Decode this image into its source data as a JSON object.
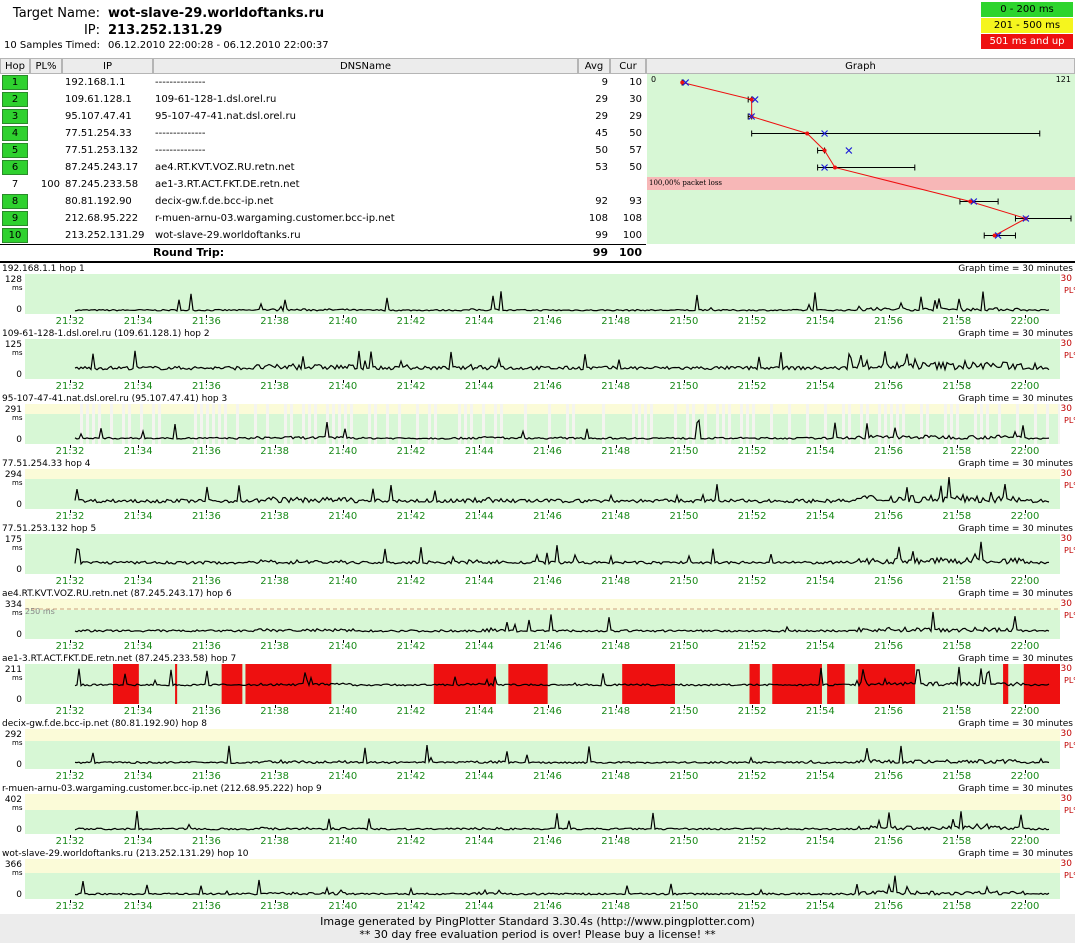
{
  "header": {
    "target_label": "Target Name:",
    "target_value": "wot-slave-29.worldoftanks.ru",
    "ip_label": "IP:",
    "ip_value": "213.252.131.29",
    "samples_label": "10 Samples Timed:",
    "samples_value": "06.12.2010 22:00:28 - 06.12.2010 22:00:37"
  },
  "legend": [
    {
      "label": "0 - 200 ms",
      "color": "#2dd42d"
    },
    {
      "label": "201 - 500 ms",
      "color": "#f5f51e"
    },
    {
      "label": "501 ms and up",
      "color": "#ee1010"
    }
  ],
  "columns": {
    "hop": "Hop",
    "pl": "PL%",
    "ip": "IP",
    "dns": "DNSName",
    "avg": "Avg",
    "cur": "Cur",
    "graph": "Graph"
  },
  "hops": [
    {
      "hop": "1",
      "pl": "",
      "ip": "192.168.1.1",
      "dns": "--------------",
      "avg": "9",
      "cur": "10",
      "ok": true
    },
    {
      "hop": "2",
      "pl": "",
      "ip": "109.61.128.1",
      "dns": "109-61-128-1.dsl.orel.ru",
      "avg": "29",
      "cur": "30",
      "ok": true
    },
    {
      "hop": "3",
      "pl": "",
      "ip": "95.107.47.41",
      "dns": "95-107-47-41.nat.dsl.orel.ru",
      "avg": "29",
      "cur": "29",
      "ok": true
    },
    {
      "hop": "4",
      "pl": "",
      "ip": "77.51.254.33",
      "dns": "--------------",
      "avg": "45",
      "cur": "50",
      "ok": true
    },
    {
      "hop": "5",
      "pl": "",
      "ip": "77.51.253.132",
      "dns": "--------------",
      "avg": "50",
      "cur": "57",
      "ok": true
    },
    {
      "hop": "6",
      "pl": "",
      "ip": "87.245.243.17",
      "dns": "ae4.RT.KVT.VOZ.RU.retn.net",
      "avg": "53",
      "cur": "50",
      "ok": true
    },
    {
      "hop": "7",
      "pl": "100",
      "ip": "87.245.233.58",
      "dns": "ae1-3.RT.ACT.FKT.DE.retn.net",
      "avg": "",
      "cur": "",
      "ok": false
    },
    {
      "hop": "8",
      "pl": "",
      "ip": "80.81.192.90",
      "dns": "decix-gw.f.de.bcc-ip.net",
      "avg": "92",
      "cur": "93",
      "ok": true
    },
    {
      "hop": "9",
      "pl": "",
      "ip": "212.68.95.222",
      "dns": "r-muen-arnu-03.wargaming.customer.bcc-ip.net",
      "avg": "108",
      "cur": "108",
      "ok": true
    },
    {
      "hop": "10",
      "pl": "",
      "ip": "213.252.131.29",
      "dns": "wot-slave-29.worldoftanks.ru",
      "avg": "99",
      "cur": "100",
      "ok": true
    }
  ],
  "round_trip": {
    "label": "Round Trip:",
    "avg": "99",
    "cur": "100"
  },
  "graph": {
    "min_label": "0",
    "max_label": "121",
    "loss_label": "100,00% packet loss",
    "max_ms": 121,
    "avg": [
      9,
      29,
      29,
      45,
      50,
      53,
      null,
      92,
      108,
      99
    ],
    "cur": [
      10,
      30,
      29,
      50,
      57,
      50,
      null,
      93,
      108,
      100
    ],
    "min": [
      9,
      28,
      28,
      29,
      48,
      48,
      null,
      89,
      105,
      96
    ],
    "max": [
      9,
      29,
      29,
      112,
      50,
      76,
      null,
      100,
      121,
      105
    ]
  },
  "time_graphs": {
    "graph_time": "Graph time = 30 minutes",
    "ms_label": "ms",
    "pl_max": "30",
    "pl_label": "PL%",
    "ticks": [
      "21:32",
      "21:34",
      "21:36",
      "21:38",
      "21:40",
      "21:42",
      "21:44",
      "21:46",
      "21:48",
      "21:50",
      "21:52",
      "21:54",
      "21:56",
      "21:58",
      "22:00"
    ],
    "panels": [
      {
        "title": "192.168.1.1 hop 1",
        "ymax": "128",
        "yzero": "0"
      },
      {
        "title": "109-61-128-1.dsl.orel.ru (109.61.128.1) hop 2",
        "ymax": "125",
        "yzero": "0"
      },
      {
        "title": "95-107-47-41.nat.dsl.orel.ru (95.107.47.41) hop 3",
        "ymax": "291",
        "yzero": "0"
      },
      {
        "title": "77.51.254.33 hop 4",
        "ymax": "294",
        "yzero": "0"
      },
      {
        "title": "77.51.253.132 hop 5",
        "ymax": "175",
        "yzero": "0"
      },
      {
        "title": "ae4.RT.KVT.VOZ.RU.retn.net (87.245.243.17) hop 6",
        "ymax": "334",
        "yzero": "0",
        "threshold": "250 ms"
      },
      {
        "title": "ae1-3.RT.ACT.FKT.DE.retn.net (87.245.233.58) hop 7",
        "ymax": "211",
        "yzero": "0"
      },
      {
        "title": "decix-gw.f.de.bcc-ip.net (80.81.192.90) hop 8",
        "ymax": "292",
        "yzero": "0"
      },
      {
        "title": "r-muen-arnu-03.wargaming.customer.bcc-ip.net (212.68.95.222) hop 9",
        "ymax": "402",
        "yzero": "0"
      },
      {
        "title": "wot-slave-29.worldoftanks.ru (213.252.131.29) hop 10",
        "ymax": "366",
        "yzero": "0"
      }
    ]
  },
  "footer": {
    "line1": "Image generated by PingPlotter Standard 3.30.4s (http://www.pingplotter.com)",
    "line2": "** 30 day free evaluation period is over!  Please buy a license! **"
  }
}
